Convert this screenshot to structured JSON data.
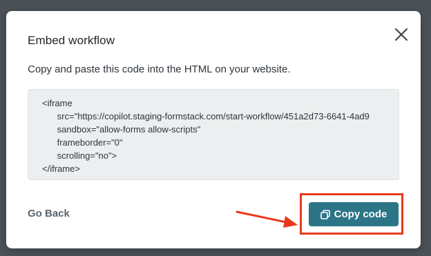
{
  "dialog": {
    "title": "Embed workflow",
    "description": "Copy and paste this code into the HTML on your website.",
    "close_icon": "close-icon"
  },
  "code": {
    "lines": [
      "<iframe",
      "      src=\"https://copilot.staging-formstack.com/start-workflow/451a2d73-6641-4ad9",
      "      sandbox=\"allow-forms allow-scripts\"",
      "      frameborder=\"0\"",
      "      scrolling=\"no\">",
      "</iframe>"
    ]
  },
  "actions": {
    "go_back_label": "Go Back",
    "copy_label": "Copy code",
    "copy_icon": "copy-icon"
  },
  "colors": {
    "overlay": "#4a5157",
    "primary_button": "#2b7587",
    "annotation": "#e8391f"
  }
}
